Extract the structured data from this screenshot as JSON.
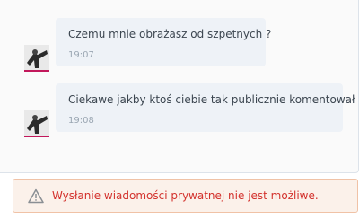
{
  "messages": [
    {
      "text": "Czemu mnie obrażasz od szpetnych ?",
      "time": "19:07"
    },
    {
      "text": "Ciekawe jakby ktoś ciebie tak publicznie komentował",
      "time": "19:08"
    }
  ],
  "alert": {
    "text": "Wysłanie wiadomości prywatnej nie jest możliwe.",
    "icon": "warning-triangle-icon"
  },
  "colors": {
    "bubble": "#eef2f7",
    "alert_text": "#d3312c",
    "alert_background": "#fbf1ea",
    "avatar_underline": "#c2185b"
  }
}
